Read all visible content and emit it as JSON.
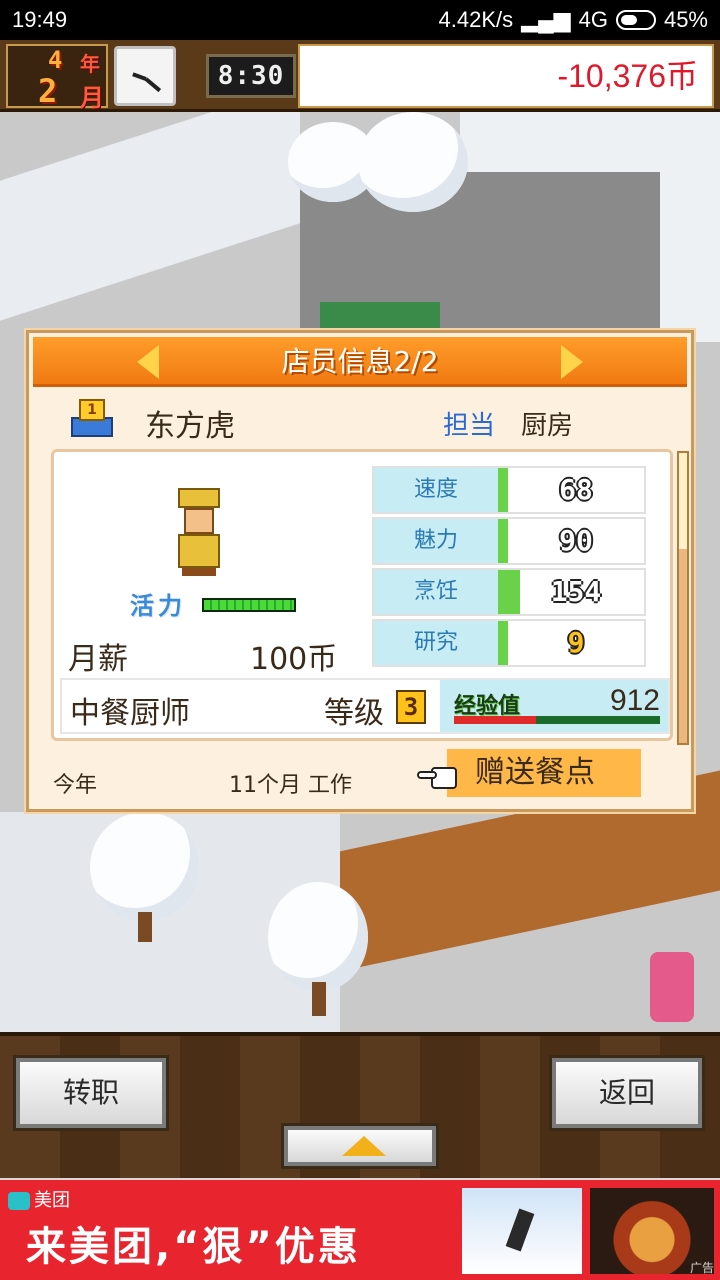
{
  "status_bar": {
    "time": "19:49",
    "network_speed": "4.42K/s",
    "network_type": "4G",
    "battery": "45%"
  },
  "hud": {
    "year_num": "4",
    "year_unit": "年",
    "month_num": "2",
    "month_unit": "月",
    "digital_time": "8:30",
    "money": "-10,376币"
  },
  "dialog": {
    "title": "店员信息2/2",
    "rank": "1",
    "staff_name": "东方虎",
    "duty_label": "担当",
    "duty_value": "厨房",
    "vitality_label": "活力",
    "vitality_level": 1.0,
    "salary_label": "月薪",
    "salary_value": "100币",
    "stats": [
      {
        "name": "速度",
        "value": "68",
        "bar": 0.07
      },
      {
        "name": "魅力",
        "value": "90",
        "bar": 0.07
      },
      {
        "name": "烹饪",
        "value": "154",
        "bar": 0.15
      },
      {
        "name": "研究",
        "value": "9",
        "bar": 0.07
      }
    ],
    "job": "中餐厨师",
    "level_label": "等级",
    "level_value": "3",
    "exp_label": "经验值",
    "exp_value": "912",
    "exp_progress": 0.4,
    "footer_year": "今年",
    "footer_months": "11个月 工作",
    "gift_button": "赠送餐点"
  },
  "bottom": {
    "transfer_button": "转职",
    "back_button": "返回"
  },
  "ad": {
    "brand": "美团",
    "slogan": "来美团,“狠”优惠",
    "tag": "广告"
  }
}
